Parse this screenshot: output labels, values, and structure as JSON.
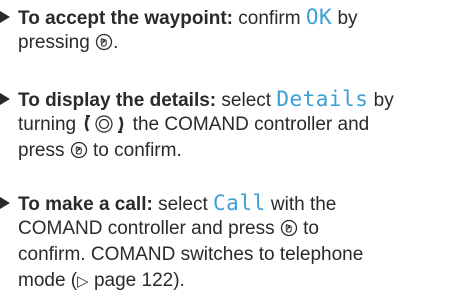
{
  "steps": [
    {
      "heading": "To accept the waypoint:",
      "text1": " confirm ",
      "display": "OK",
      "text2": " by",
      "line2": "pressing",
      "line2_end": "."
    },
    {
      "heading": "To display the details:",
      "text1": " select ",
      "display": "Details",
      "text2": " by",
      "line2_start": "turning",
      "line2_end": " the COMAND controller and",
      "line3_start": "press",
      "line3_end": " to confirm."
    },
    {
      "heading": "To make a call:",
      "text1": " select ",
      "display": "Call",
      "text2": " with the",
      "line2_start": "COMAND controller and press",
      "line2_end": " to",
      "line3": "confirm. COMAND switches to telephone",
      "line4_start": "mode (",
      "line4_ref": " page 122)."
    }
  ],
  "icons": {
    "bullet": "triangle-bullet-icon",
    "press": "press-controller-icon",
    "turn": "turn-controller-icon",
    "reference": "page-reference-icon"
  },
  "colors": {
    "text": "#2a2a2a",
    "display_text": "#3aa0d5"
  }
}
